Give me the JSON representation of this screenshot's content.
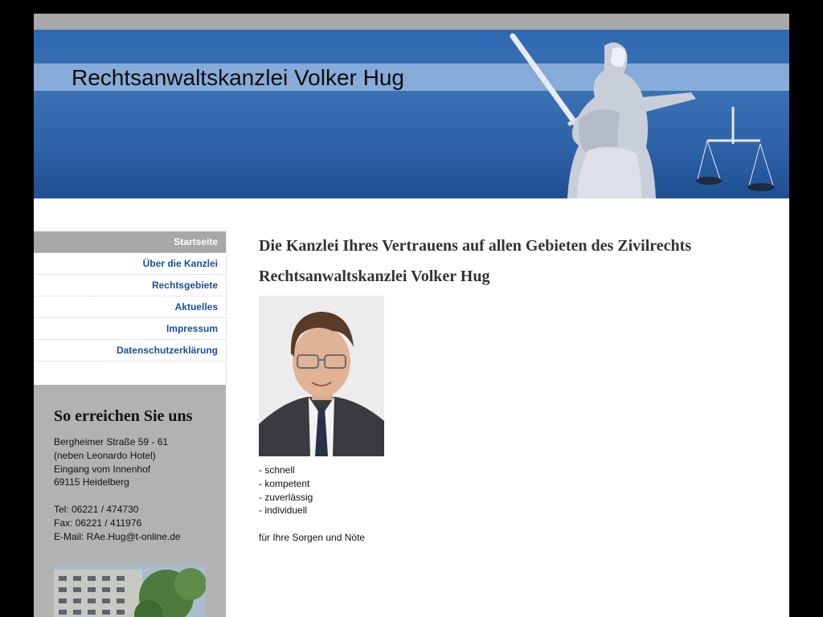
{
  "header": {
    "site_title": "Rechtsanwaltskanzlei Volker Hug"
  },
  "nav": {
    "items": [
      {
        "label": "Startseite",
        "active": true
      },
      {
        "label": "Über die Kanzlei",
        "active": false
      },
      {
        "label": "Rechtsgebiete",
        "active": false
      },
      {
        "label": "Aktuelles",
        "active": false
      },
      {
        "label": "Impressum",
        "active": false
      },
      {
        "label": "Datenschutzerklärung",
        "active": false
      }
    ]
  },
  "sidebar": {
    "heading": "So erreichen Sie uns",
    "address": [
      "Bergheimer Straße 59 - 61",
      "(neben Leonardo Hotel)",
      "Eingang vom Innenhof",
      "69115 Heidelberg"
    ],
    "contact": [
      "Tel: 06221 / 474730",
      "Fax: 06221 / 411976",
      "E-Mail: RAe.Hug@t-online.de"
    ]
  },
  "main": {
    "heading": "Die Kanzlei Ihres Vertrauens auf allen Gebieten des Zivilrechts",
    "subheading": "Rechtsanwaltskanzlei Volker Hug",
    "qualities": [
      "- schnell",
      "- kompetent",
      "- zuverlässig",
      "- individuell"
    ],
    "closing": "für Ihre Sorgen und Nöte"
  },
  "colors": {
    "nav_link": "#1a4fa0",
    "nav_active_bg": "#a8a8a8",
    "header_blue": "#2f68b0",
    "sidebar_bg": "#b2b2b2"
  }
}
